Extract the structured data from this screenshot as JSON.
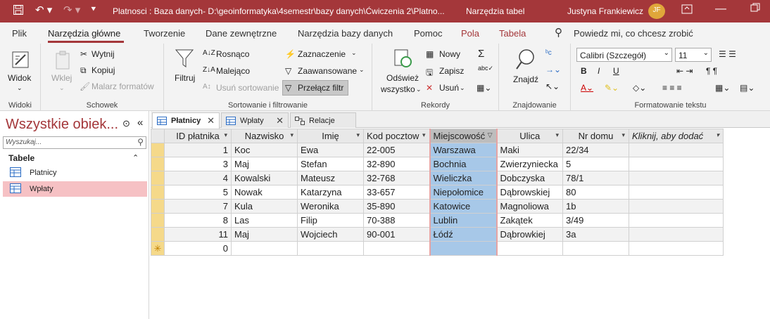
{
  "titlebar": {
    "title": "Platnosci : Baza danych- D:\\geoinformatyka\\4semestr\\bazy danych\\Ćwiczenia 2\\Platno...",
    "context": "Narzędzia tabel",
    "user": "Justyna Frankiewicz",
    "initials": "JF"
  },
  "ribbon_tabs": [
    "Plik",
    "Narzędzia główne",
    "Tworzenie",
    "Dane zewnętrzne",
    "Narzędzia bazy danych",
    "Pomoc",
    "Pola",
    "Tabela"
  ],
  "tell_me": "Powiedz mi, co chcesz zrobić",
  "groups": {
    "widoki": {
      "label": "Widoki",
      "view": "Widok"
    },
    "schowek": {
      "label": "Schowek",
      "paste": "Wklej",
      "cut": "Wytnij",
      "copy": "Kopiuj",
      "painter": "Malarz formatów"
    },
    "sort": {
      "label": "Sortowanie i filtrowanie",
      "filter": "Filtruj",
      "asc": "Rosnąco",
      "desc": "Malejąco",
      "remove": "Usuń sortowanie",
      "selection": "Zaznaczenie",
      "advanced": "Zaawansowane",
      "toggle": "Przełącz filtr"
    },
    "records": {
      "label": "Rekordy",
      "refresh1": "Odśwież",
      "refresh2": "wszystko",
      "new": "Nowy",
      "save": "Zapisz",
      "delete": "Usuń"
    },
    "find": {
      "label": "Znajdowanie",
      "find": "Znajdź"
    },
    "text": {
      "label": "Formatowanie tekstu",
      "font": "Calibri (Szczegół)",
      "size": "11"
    }
  },
  "nav": {
    "title": "Wszystkie obiek...",
    "search_placeholder": "Wyszukaj...",
    "section": "Tabele",
    "items": [
      "Platnicy",
      "Wpłaty"
    ]
  },
  "doc_tabs": [
    "Płatnicy",
    "Wpłaty",
    "Relacje"
  ],
  "table": {
    "columns": [
      "ID płatnika",
      "Nazwisko",
      "Imię",
      "Kod pocztow",
      "Miejscowość",
      "Ulica",
      "Nr domu",
      "Kliknij, aby dodać"
    ],
    "rows": [
      [
        "1",
        "Koc",
        "Ewa",
        "22-005",
        "Warszawa",
        "Maki",
        "22/34"
      ],
      [
        "3",
        "Maj",
        "Stefan",
        "32-890",
        "Bochnia",
        "Zwierzyniecka",
        "5"
      ],
      [
        "4",
        "Kowalski",
        "Mateusz",
        "32-768",
        "Wieliczka",
        "Dobczyska",
        "78/1"
      ],
      [
        "5",
        "Nowak",
        "Katarzyna",
        "33-657",
        "Niepołomice",
        "Dąbrowskiej",
        "80"
      ],
      [
        "7",
        "Kula",
        "Weronika",
        "35-890",
        "Katowice",
        "Magnoliowa",
        "1b"
      ],
      [
        "8",
        "Las",
        "Filip",
        "70-388",
        "Lublin",
        "Zakątek",
        "3/49"
      ],
      [
        "11",
        "Maj",
        "Wojciech",
        "90-001",
        "Łódź",
        "Dąbrowkiej",
        "3a"
      ]
    ],
    "new_row_id": "0"
  },
  "colors": {
    "accent": "#a4373a",
    "selected_column": "#a7c8e8",
    "record_selector": "#f5d98a"
  }
}
